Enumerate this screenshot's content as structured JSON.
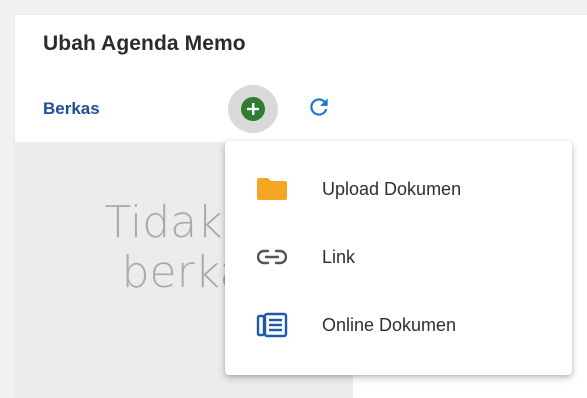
{
  "dialog": {
    "title": "Ubah Agenda Memo"
  },
  "files": {
    "label": "Berkas",
    "add_icon": "add-circle-icon",
    "refresh_icon": "refresh-icon",
    "empty_line1": "Tidak a",
    "empty_line2": "berka"
  },
  "menu": {
    "items": [
      {
        "label": "Upload Dokumen",
        "icon": "folder-icon"
      },
      {
        "label": "Link",
        "icon": "link-icon"
      },
      {
        "label": "Online Dokumen",
        "icon": "online-document-icon"
      }
    ]
  },
  "colors": {
    "accent_blue": "#1f4e99",
    "add_green": "#2e7d32",
    "folder_orange": "#f5a623",
    "refresh_blue": "#1976d2",
    "doc_blue": "#1e5aa8"
  }
}
